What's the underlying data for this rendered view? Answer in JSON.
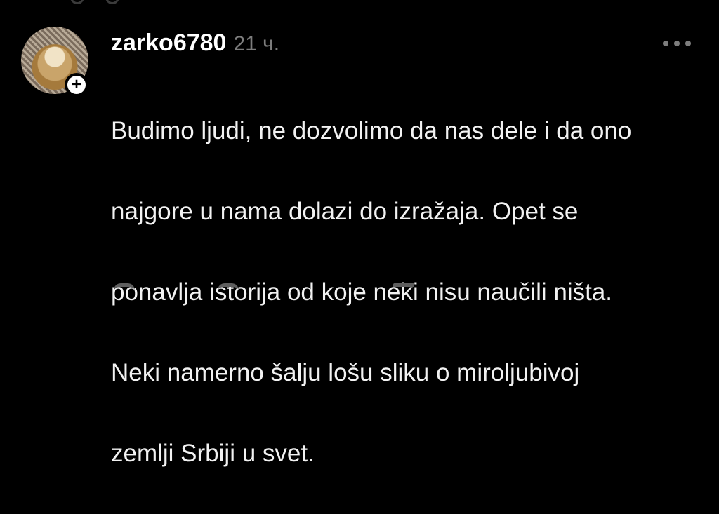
{
  "comment": {
    "username": "zarko6780",
    "timestamp": "21 ч.",
    "text_lines": [
      "Budimo ljudi, ne dozvolimo da nas dele i da ono",
      "najgore u nama dolazi do izražaja. Opet se",
      "ponavlja istorija od koje neki nisu naučili ništa.",
      "Neki namerno šalju lošu sliku o miroljubivoj",
      "zemlji Srbiji u svet."
    ],
    "follow_icon": "plus-icon",
    "menu_icon": "more-horizontal-icon"
  },
  "colors": {
    "background": "#000000",
    "text": "#f2f2f2",
    "muted": "#7d7d7d"
  }
}
